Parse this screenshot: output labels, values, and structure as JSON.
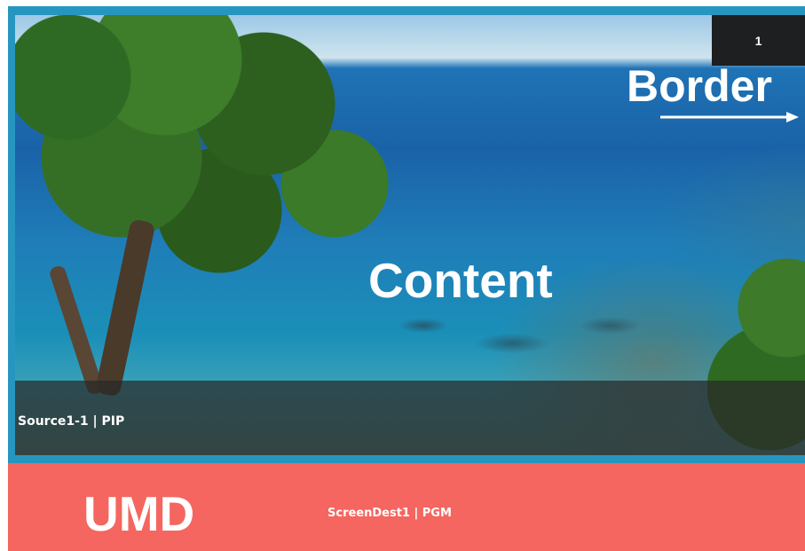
{
  "window": {
    "number": "1"
  },
  "annotations": {
    "border": "Border",
    "content": "Content",
    "umd": "UMD"
  },
  "source": {
    "label": "Source1-1 | PIP"
  },
  "screen": {
    "label": "ScreenDest1 | PGM"
  },
  "colors": {
    "border": "#2796bf",
    "umd_background": "#f4665f",
    "number_box": "#1e1f20",
    "source_bar": "#282828"
  }
}
